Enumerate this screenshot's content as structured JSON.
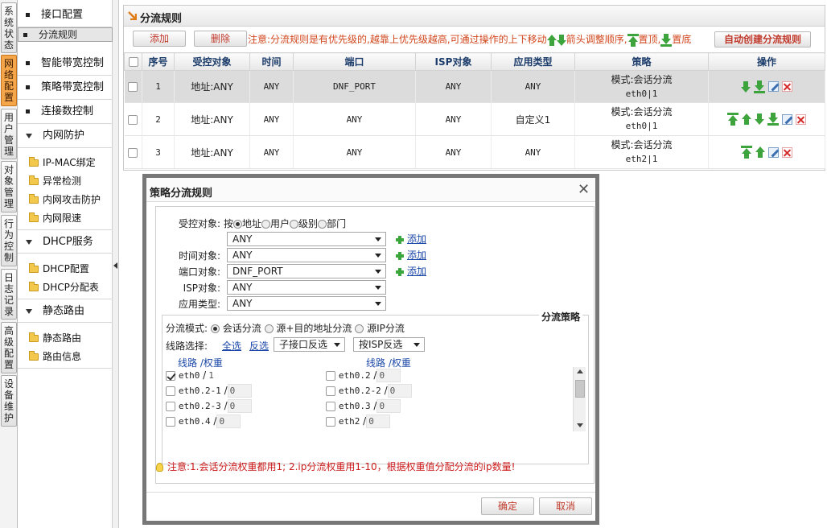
{
  "vtabs": [
    "系统状态",
    "网络配置",
    "用户管理",
    "对象管理",
    "行为控制",
    "日志记录",
    "高级配置",
    "设备维护"
  ],
  "sidebar": {
    "items": [
      "接口配置",
      "分流规则",
      "智能带宽控制",
      "策略带宽控制",
      "连接数控制"
    ],
    "groups": {
      "intranet": "内网防护",
      "intranet_items": [
        "IP-MAC绑定",
        "异常检测",
        "内网攻击防护",
        "内网限速"
      ],
      "dhcp": "DHCP服务",
      "dhcp_items": [
        "DHCP配置",
        "DHCP分配表"
      ],
      "static": "静态路由",
      "static_items": [
        "静态路由",
        "路由信息"
      ]
    }
  },
  "panel": {
    "title": "分流规则",
    "add": "添加",
    "delete": "删除",
    "notice_a": "注意:分流规则是有优先级的,越靠上优先级越高,可通过操作的上下移动",
    "notice_b": "箭头调整顺序,",
    "notice_c": "置顶,",
    "notice_d": "置底",
    "auto_create": "自动创建分流规则"
  },
  "table": {
    "headers": [
      "序号",
      "受控对象",
      "时间",
      "端口",
      "ISP对象",
      "应用类型",
      "策略",
      "操作"
    ],
    "rows": [
      {
        "no": "1",
        "target": "地址:ANY",
        "time": "ANY",
        "port": "DNF_PORT",
        "isp": "ANY",
        "app": "ANY",
        "mode": "模式:会话分流",
        "line": "eth0|1"
      },
      {
        "no": "2",
        "target": "地址:ANY",
        "time": "ANY",
        "port": "ANY",
        "isp": "ANY",
        "app": "自定义1",
        "mode": "模式:会话分流",
        "line": "eth0|1"
      },
      {
        "no": "3",
        "target": "地址:ANY",
        "time": "ANY",
        "port": "ANY",
        "isp": "ANY",
        "app": "ANY",
        "mode": "模式:会话分流",
        "line": "eth2|1"
      }
    ]
  },
  "dialog": {
    "title": "策略分流规则",
    "close": "✕",
    "target_label": "受控对象:",
    "by": "按",
    "radio_opts": [
      "地址",
      "用户",
      "级别",
      "部门"
    ],
    "target_value": "ANY",
    "add_link": "添加",
    "time_label": "时间对象:",
    "time_value": "ANY",
    "port_label": "端口对象:",
    "port_value": "DNF_PORT",
    "isp_label": "ISP对象:",
    "isp_value": "ANY",
    "app_label": "应用类型:",
    "app_value": "ANY",
    "legend": "分流策略",
    "mode_label": "分流模式:",
    "mode_opts": [
      "会话分流",
      "源+目的地址分流",
      "源IP分流"
    ],
    "line_label": "线路选择:",
    "select_all": "全选",
    "invert": "反选",
    "sub_invert": "子接口反选",
    "isp_invert": "按ISP反选",
    "col_header": "线路 /权重",
    "lines_left": [
      {
        "name": "eth0",
        "w": "1",
        "checked": true
      },
      {
        "name": "eth0.2-1",
        "w": "0",
        "checked": false
      },
      {
        "name": "eth0.2-3",
        "w": "0",
        "checked": false
      },
      {
        "name": "eth0.4",
        "w": "0",
        "checked": false
      }
    ],
    "lines_right": [
      {
        "name": "eth0.2",
        "w": "0",
        "checked": false
      },
      {
        "name": "eth0.2-2",
        "w": "0",
        "checked": false
      },
      {
        "name": "eth0.3",
        "w": "0",
        "checked": false
      },
      {
        "name": "eth2",
        "w": "0",
        "checked": false
      }
    ],
    "notice": "注意:1.会话分流权重都用1; 2.ip分流权重用1-10，根据权重值分配分流的ip数量!",
    "ok": "确定",
    "cancel": "取消"
  }
}
